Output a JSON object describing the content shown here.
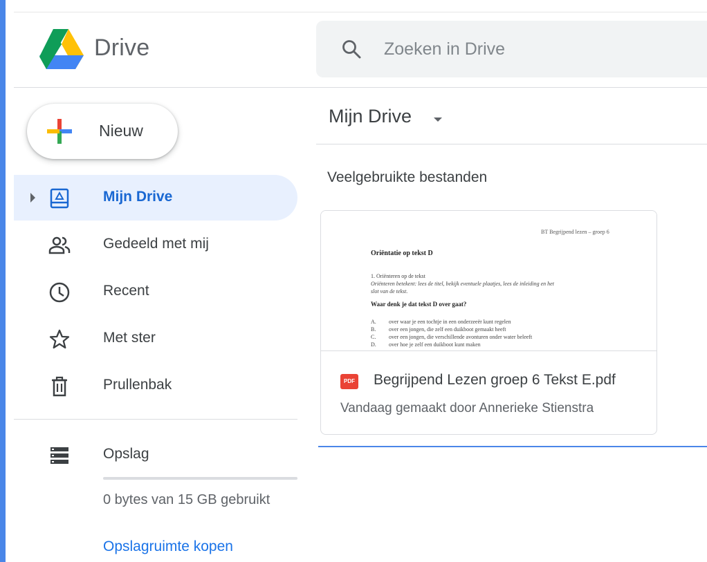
{
  "app": {
    "name": "Drive"
  },
  "search": {
    "placeholder": "Zoeken in Drive",
    "icon": "search-icon"
  },
  "new_button": {
    "label": "Nieuw"
  },
  "sidebar": {
    "items": [
      {
        "label": "Mijn Drive",
        "icon": "drive-icon",
        "active": true
      },
      {
        "label": "Gedeeld met mij",
        "icon": "shared-people-icon",
        "active": false
      },
      {
        "label": "Recent",
        "icon": "clock-icon",
        "active": false
      },
      {
        "label": "Met ster",
        "icon": "star-icon",
        "active": false
      },
      {
        "label": "Prullenbak",
        "icon": "trash-icon",
        "active": false
      }
    ],
    "storage": {
      "label": "Opslag",
      "icon": "storage-icon",
      "usage_text": "0 bytes van 15 GB gebruikt",
      "used_fraction": 0,
      "buy_link": "Opslagruimte kopen"
    }
  },
  "main": {
    "title": "Mijn Drive",
    "section_title": "Veelgebruikte bestanden",
    "files": [
      {
        "name": "Begrijpend Lezen groep 6 Tekst E.pdf",
        "subtitle": "Vandaag gemaakt door Annerieke Stienstra",
        "type_badge": "PDF",
        "preview": {
          "header": "BT Begrijpend lezen – groep 6",
          "title": "Oriëntatie op tekst D",
          "line1": "1. Oriënteren op de tekst",
          "line2": "Oriënteren betekent: lees de titel, bekijk eventuele plaatjes, lees de inleiding en het",
          "line3": "slot van de tekst.",
          "question": "Waar denk je dat tekst D over gaat?",
          "options": [
            {
              "letter": "A.",
              "text": "over waar je een tochtje in een onderzeeër kunt regelen"
            },
            {
              "letter": "B.",
              "text": "over een jongen, die zelf een duikboot gemaakt heeft"
            },
            {
              "letter": "C.",
              "text": "over een jongen, die verschillende avonturen onder water beleeft"
            },
            {
              "letter": "D.",
              "text": "over hoe je zelf een duikboot kunt maken"
            }
          ]
        }
      }
    ]
  },
  "colors": {
    "accent": "#1a73e8",
    "active_bg": "#e8f0fe",
    "left_bar": "#4a86e8"
  }
}
